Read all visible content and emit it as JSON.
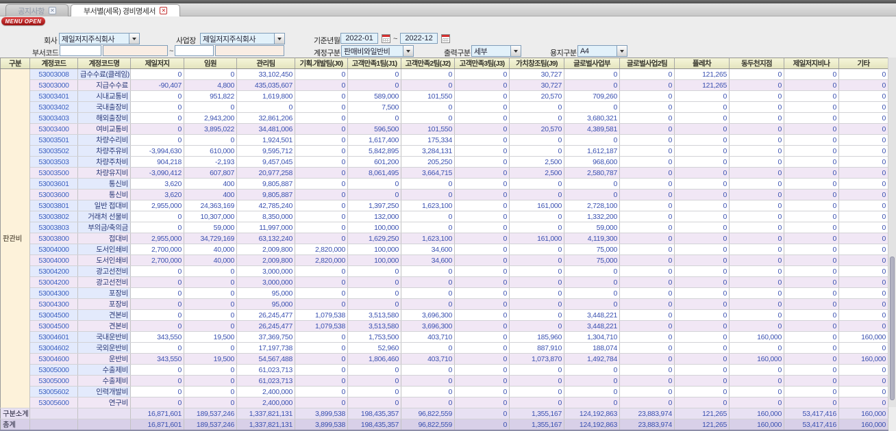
{
  "window": {
    "menu_open_label": "MENU OPEN",
    "top_tabs": [
      {
        "label": "공지사항",
        "close_icon": "✕",
        "active": false
      },
      {
        "label": "부서별(세목) 경비명세서",
        "close_icon": "✕",
        "active": true
      }
    ]
  },
  "filters": {
    "company_label": "회사",
    "company_value": "제일저지주식회사",
    "workplace_label": "사업장",
    "workplace_value": "제일저지주식회사",
    "base_month_label": "기준년월",
    "base_month_from": "2022-01",
    "base_month_to": "2022-12",
    "range_separator": "~",
    "dept_code_label": "부서코드",
    "dept_code_from_code": "",
    "dept_code_from_name": "",
    "dept_code_to_code": "",
    "dept_code_to_name": "",
    "account_type_label": "계정구분",
    "account_type_value": "판매비와일반비",
    "output_type_label": "출력구분",
    "output_type_value": "세부",
    "paper_type_label": "용지구분",
    "paper_type_value": "A4"
  },
  "colors": {
    "header_bg": "#eeeecb",
    "group_bg": "#fdf2da",
    "child_bg": "#e3eafc",
    "parent_bg": "#f1e7f5",
    "subtotal_bg": "#e8e1f3",
    "total_bg": "#d8d0e8",
    "number_text": "#3a50b0",
    "menu_open_red": "#b01616"
  },
  "table": {
    "columns": [
      "구분",
      "계정코드",
      "계정코드명",
      "제일저지",
      "임원",
      "관리팀",
      "기획.개발팀(J0)",
      "고객만족1팀(J1)",
      "고객만족2팀(J2)",
      "고객만족3팀(J3)",
      "가치창조팀(J9)",
      "글로벌사업부",
      "글로벌사업2팀",
      "플레차",
      "동두천지점",
      "제일저지비나",
      "기타"
    ],
    "group_label": "판관비",
    "rows": [
      {
        "code": "53003008",
        "name": "급수수료(클레임)",
        "type": "child",
        "values": [
          "0",
          "0",
          "33,102,450",
          "0",
          "0",
          "0",
          "0",
          "30,727",
          "0",
          "0",
          "121,265",
          "0",
          "0",
          "0"
        ]
      },
      {
        "code": "53003000",
        "name": "지급수수료",
        "type": "parent",
        "values": [
          "-90,407",
          "4,800",
          "435,035,607",
          "0",
          "0",
          "0",
          "0",
          "30,727",
          "0",
          "0",
          "121,265",
          "0",
          "0",
          "0"
        ]
      },
      {
        "code": "53003401",
        "name": "시내교통비",
        "type": "child",
        "values": [
          "0",
          "951,822",
          "1,619,800",
          "0",
          "589,000",
          "101,550",
          "0",
          "20,570",
          "709,260",
          "0",
          "0",
          "0",
          "0",
          "0"
        ]
      },
      {
        "code": "53003402",
        "name": "국내출장비",
        "type": "child",
        "values": [
          "0",
          "0",
          "0",
          "0",
          "7,500",
          "0",
          "0",
          "0",
          "0",
          "0",
          "0",
          "0",
          "0",
          "0"
        ]
      },
      {
        "code": "53003403",
        "name": "해외출장비",
        "type": "child",
        "values": [
          "0",
          "2,943,200",
          "32,861,206",
          "0",
          "0",
          "0",
          "0",
          "0",
          "3,680,321",
          "0",
          "0",
          "0",
          "0",
          "0"
        ]
      },
      {
        "code": "53003400",
        "name": "여비교통비",
        "type": "parent",
        "values": [
          "0",
          "3,895,022",
          "34,481,006",
          "0",
          "596,500",
          "101,550",
          "0",
          "20,570",
          "4,389,581",
          "0",
          "0",
          "0",
          "0",
          "0"
        ]
      },
      {
        "code": "53003501",
        "name": "차량수리비",
        "type": "child",
        "values": [
          "0",
          "0",
          "1,924,501",
          "0",
          "1,617,400",
          "175,334",
          "0",
          "0",
          "0",
          "0",
          "0",
          "0",
          "0",
          "0"
        ]
      },
      {
        "code": "53003502",
        "name": "차량주유비",
        "type": "child",
        "values": [
          "-3,994,630",
          "610,000",
          "9,595,712",
          "0",
          "5,842,895",
          "3,284,131",
          "0",
          "0",
          "1,612,187",
          "0",
          "0",
          "0",
          "0",
          "0"
        ]
      },
      {
        "code": "53003503",
        "name": "차량주차비",
        "type": "child",
        "values": [
          "904,218",
          "-2,193",
          "9,457,045",
          "0",
          "601,200",
          "205,250",
          "0",
          "2,500",
          "968,600",
          "0",
          "0",
          "0",
          "0",
          "0"
        ]
      },
      {
        "code": "53003500",
        "name": "차량유지비",
        "type": "parent",
        "values": [
          "-3,090,412",
          "607,807",
          "20,977,258",
          "0",
          "8,061,495",
          "3,664,715",
          "0",
          "2,500",
          "2,580,787",
          "0",
          "0",
          "0",
          "0",
          "0"
        ]
      },
      {
        "code": "53003601",
        "name": "통신비",
        "type": "child",
        "values": [
          "3,620",
          "400",
          "9,805,887",
          "0",
          "0",
          "0",
          "0",
          "0",
          "0",
          "0",
          "0",
          "0",
          "0",
          "0"
        ]
      },
      {
        "code": "53003600",
        "name": "통신비",
        "type": "parent",
        "values": [
          "3,620",
          "400",
          "9,805,887",
          "0",
          "0",
          "0",
          "0",
          "0",
          "0",
          "0",
          "0",
          "0",
          "0",
          "0"
        ]
      },
      {
        "code": "53003801",
        "name": "일반 접대비",
        "type": "child",
        "values": [
          "2,955,000",
          "24,363,169",
          "42,785,240",
          "0",
          "1,397,250",
          "1,623,100",
          "0",
          "161,000",
          "2,728,100",
          "0",
          "0",
          "0",
          "0",
          "0"
        ]
      },
      {
        "code": "53003802",
        "name": "거래처 선물비",
        "type": "child",
        "values": [
          "0",
          "10,307,000",
          "8,350,000",
          "0",
          "132,000",
          "0",
          "0",
          "0",
          "1,332,200",
          "0",
          "0",
          "0",
          "0",
          "0"
        ]
      },
      {
        "code": "53003803",
        "name": "부의금/축의금",
        "type": "child",
        "values": [
          "0",
          "59,000",
          "11,997,000",
          "0",
          "100,000",
          "0",
          "0",
          "0",
          "59,000",
          "0",
          "0",
          "0",
          "0",
          "0"
        ]
      },
      {
        "code": "53003800",
        "name": "접대비",
        "type": "parent",
        "values": [
          "2,955,000",
          "34,729,169",
          "63,132,240",
          "0",
          "1,629,250",
          "1,623,100",
          "0",
          "161,000",
          "4,119,300",
          "0",
          "0",
          "0",
          "0",
          "0"
        ]
      },
      {
        "code": "53004000",
        "name": "도서인쇄비",
        "type": "child",
        "values": [
          "2,700,000",
          "40,000",
          "2,009,800",
          "2,820,000",
          "100,000",
          "34,600",
          "0",
          "0",
          "75,000",
          "0",
          "0",
          "0",
          "0",
          "0"
        ]
      },
      {
        "code": "53004000",
        "name": "도서인쇄비",
        "type": "parent",
        "values": [
          "2,700,000",
          "40,000",
          "2,009,800",
          "2,820,000",
          "100,000",
          "34,600",
          "0",
          "0",
          "75,000",
          "0",
          "0",
          "0",
          "0",
          "0"
        ]
      },
      {
        "code": "53004200",
        "name": "광고선전비",
        "type": "child",
        "values": [
          "0",
          "0",
          "3,000,000",
          "0",
          "0",
          "0",
          "0",
          "0",
          "0",
          "0",
          "0",
          "0",
          "0",
          "0"
        ]
      },
      {
        "code": "53004200",
        "name": "광고선전비",
        "type": "parent",
        "values": [
          "0",
          "0",
          "3,000,000",
          "0",
          "0",
          "0",
          "0",
          "0",
          "0",
          "0",
          "0",
          "0",
          "0",
          "0"
        ]
      },
      {
        "code": "53004300",
        "name": "포장비",
        "type": "child",
        "values": [
          "0",
          "0",
          "95,000",
          "0",
          "0",
          "0",
          "0",
          "0",
          "0",
          "0",
          "0",
          "0",
          "0",
          "0"
        ]
      },
      {
        "code": "53004300",
        "name": "포장비",
        "type": "parent",
        "values": [
          "0",
          "0",
          "95,000",
          "0",
          "0",
          "0",
          "0",
          "0",
          "0",
          "0",
          "0",
          "0",
          "0",
          "0"
        ]
      },
      {
        "code": "53004500",
        "name": "견본비",
        "type": "child",
        "values": [
          "0",
          "0",
          "26,245,477",
          "1,079,538",
          "3,513,580",
          "3,696,300",
          "0",
          "0",
          "3,448,221",
          "0",
          "0",
          "0",
          "0",
          "0"
        ]
      },
      {
        "code": "53004500",
        "name": "견본비",
        "type": "parent",
        "values": [
          "0",
          "0",
          "26,245,477",
          "1,079,538",
          "3,513,580",
          "3,696,300",
          "0",
          "0",
          "3,448,221",
          "0",
          "0",
          "0",
          "0",
          "0"
        ]
      },
      {
        "code": "53004601",
        "name": "국내운반비",
        "type": "child",
        "values": [
          "343,550",
          "19,500",
          "37,369,750",
          "0",
          "1,753,500",
          "403,710",
          "0",
          "185,960",
          "1,304,710",
          "0",
          "0",
          "160,000",
          "0",
          "160,000"
        ]
      },
      {
        "code": "53004602",
        "name": "국외운반비",
        "type": "child",
        "values": [
          "0",
          "0",
          "17,197,738",
          "0",
          "52,960",
          "0",
          "0",
          "887,910",
          "188,074",
          "0",
          "0",
          "0",
          "0",
          "0"
        ]
      },
      {
        "code": "53004600",
        "name": "운반비",
        "type": "parent",
        "values": [
          "343,550",
          "19,500",
          "54,567,488",
          "0",
          "1,806,460",
          "403,710",
          "0",
          "1,073,870",
          "1,492,784",
          "0",
          "0",
          "160,000",
          "0",
          "160,000"
        ]
      },
      {
        "code": "53005000",
        "name": "수출제비",
        "type": "child",
        "values": [
          "0",
          "0",
          "61,023,713",
          "0",
          "0",
          "0",
          "0",
          "0",
          "0",
          "0",
          "0",
          "0",
          "0",
          "0"
        ]
      },
      {
        "code": "53005000",
        "name": "수출제비",
        "type": "parent",
        "values": [
          "0",
          "0",
          "61,023,713",
          "0",
          "0",
          "0",
          "0",
          "0",
          "0",
          "0",
          "0",
          "0",
          "0",
          "0"
        ]
      },
      {
        "code": "53005602",
        "name": "인력개발비",
        "type": "child",
        "values": [
          "0",
          "0",
          "2,400,000",
          "0",
          "0",
          "0",
          "0",
          "0",
          "0",
          "0",
          "0",
          "0",
          "0",
          "0"
        ]
      },
      {
        "code": "53005600",
        "name": "연구비",
        "type": "parent",
        "values": [
          "0",
          "0",
          "2,400,000",
          "0",
          "0",
          "0",
          "0",
          "0",
          "0",
          "0",
          "0",
          "0",
          "0",
          "0"
        ]
      }
    ],
    "subtotal": {
      "label": "구분소계",
      "values": [
        "16,871,601",
        "189,537,246",
        "1,337,821,131",
        "3,899,538",
        "198,435,357",
        "96,822,559",
        "0",
        "1,355,167",
        "124,192,863",
        "23,883,974",
        "121,265",
        "160,000",
        "53,417,416",
        "160,000"
      ]
    },
    "total": {
      "label": "총계",
      "values": [
        "16,871,601",
        "189,537,246",
        "1,337,821,131",
        "3,899,538",
        "198,435,357",
        "96,822,559",
        "0",
        "1,355,167",
        "124,192,863",
        "23,883,974",
        "121,265",
        "160,000",
        "53,417,416",
        "160,000"
      ]
    }
  }
}
